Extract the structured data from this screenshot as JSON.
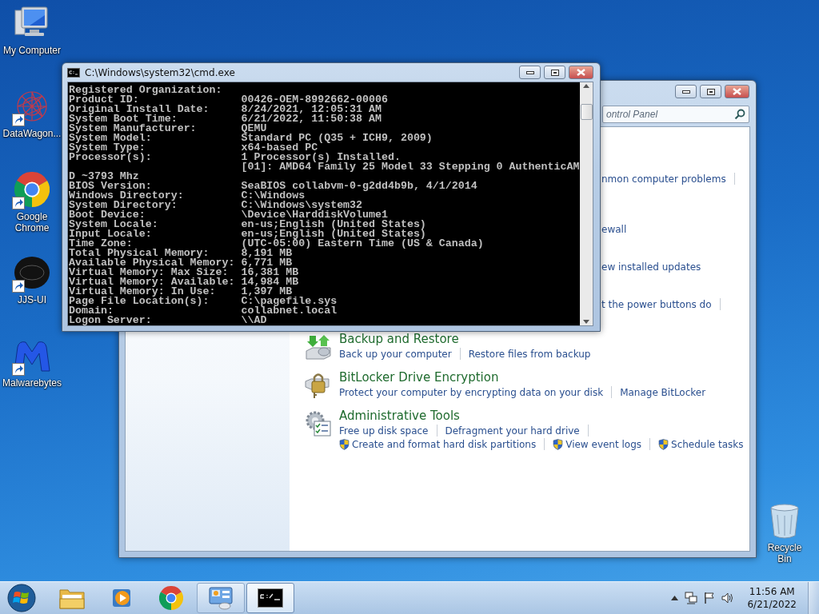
{
  "desktop_icons": [
    {
      "kind": "computer",
      "label": "My Computer"
    },
    {
      "kind": "network",
      "label": "DataWagon...",
      "shortcut": true
    },
    {
      "kind": "chrome",
      "label": "Google Chrome",
      "shortcut": true
    },
    {
      "kind": "dark-badge",
      "label": "JJS-UI",
      "shortcut": true
    },
    {
      "kind": "malwarebytes",
      "label": "Malwarebytes",
      "shortcut": true
    }
  ],
  "recycle_bin": {
    "label": "Recycle Bin"
  },
  "control_panel": {
    "search": {
      "placeholder": "ontrol Panel"
    },
    "partial_rows": [
      {
        "text": "nmon computer problems",
        "trailing_divider": true
      },
      {
        "text": "ewall"
      },
      {
        "text": "ew installed updates"
      },
      {
        "text": "t the power buttons do",
        "trailing_divider": true
      }
    ],
    "categories": [
      {
        "kind": "backup",
        "title": "Backup and Restore",
        "lines": [
          {
            "links": [
              {
                "text": "Back up your computer"
              },
              {
                "text": "Restore files from backup"
              }
            ]
          }
        ]
      },
      {
        "kind": "bitlocker",
        "title": "BitLocker Drive Encryption",
        "lines": [
          {
            "links": [
              {
                "text": "Protect your computer by encrypting data on your disk"
              },
              {
                "text": "Manage BitLocker"
              }
            ]
          }
        ]
      },
      {
        "kind": "admin",
        "title": "Administrative Tools",
        "lines": [
          {
            "links": [
              {
                "text": "Free up disk space"
              },
              {
                "text": "Defragment your hard drive"
              }
            ],
            "trailing_divider": true
          },
          {
            "links": [
              {
                "text": "Create and format hard disk partitions",
                "shield": true
              },
              {
                "text": "View event logs",
                "shield": true
              },
              {
                "text": "Schedule tasks",
                "shield": true
              }
            ]
          }
        ]
      }
    ]
  },
  "cmd_window": {
    "title": "C:\\Windows\\system32\\cmd.exe",
    "lines": [
      "Registered Organization:",
      "Product ID:                00426-OEM-8992662-00006",
      "Original Install Date:     8/24/2021, 12:05:31 AM",
      "System Boot Time:          6/21/2022, 11:50:38 AM",
      "System Manufacturer:       QEMU",
      "System Model:              Standard PC (Q35 + ICH9, 2009)",
      "System Type:               x64-based PC",
      "Processor(s):              1 Processor(s) Installed.",
      "                           [01]: AMD64 Family 25 Model 33 Stepping 0 AuthenticAM",
      "D ~3793 Mhz",
      "BIOS Version:              SeaBIOS collabvm-0-g2dd4b9b, 4/1/2014",
      "Windows Directory:         C:\\Windows",
      "System Directory:          C:\\Windows\\system32",
      "Boot Device:               \\Device\\HarddiskVolume1",
      "System Locale:             en-us;English (United States)",
      "Input Locale:              en-us;English (United States)",
      "Time Zone:                 (UTC-05:00) Eastern Time (US & Canada)",
      "Total Physical Memory:     8,191 MB",
      "Available Physical Memory: 6,771 MB",
      "Virtual Memory: Max Size:  16,381 MB",
      "Virtual Memory: Available: 14,984 MB",
      "Virtual Memory: In Use:    1,397 MB",
      "Page File Location(s):     C:\\pagefile.sys",
      "Domain:                    collabnet.local",
      "Logon Server:              \\\\AD"
    ]
  },
  "taskbar_buttons": [
    {
      "kind": "explorer",
      "open": false,
      "focused": false
    },
    {
      "kind": "media-player",
      "open": false,
      "focused": false
    },
    {
      "kind": "chrome",
      "open": false,
      "focused": false
    },
    {
      "kind": "control-panel",
      "open": true,
      "focused": false
    },
    {
      "kind": "console",
      "open": true,
      "focused": true
    }
  ],
  "tray": {
    "time": "11:56 AM",
    "date": "6/21/2022"
  }
}
